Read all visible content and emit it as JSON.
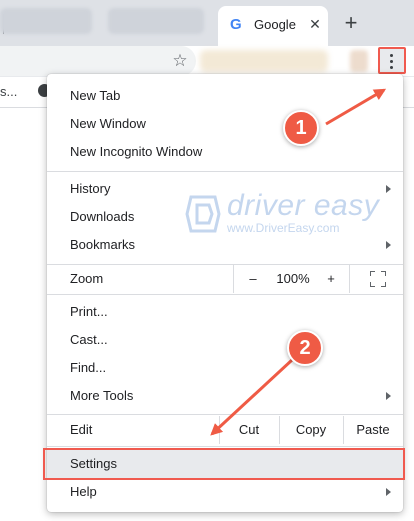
{
  "browser": {
    "active_tab_title": "Google",
    "tab_close_glyph": "✕",
    "new_tab_glyph": "+",
    "favicon_letter": "G",
    "bookmark_star_glyph": "☆",
    "bookmarks_bar_text": "s...",
    "icons": {
      "favicon": "google-g-icon",
      "close": "close-icon",
      "new_tab": "plus-icon",
      "bookmark": "star-icon",
      "menu": "three-dots-vertical-icon"
    }
  },
  "menu": {
    "items": {
      "new_tab": "New Tab",
      "new_window": "New Window",
      "new_incognito": "New Incognito Window",
      "history": "History",
      "downloads": "Downloads",
      "bookmarks": "Bookmarks",
      "zoom": "Zoom",
      "print": "Print...",
      "cast": "Cast...",
      "find": "Find...",
      "more_tools": "More Tools",
      "edit": "Edit",
      "settings": "Settings",
      "help": "Help"
    },
    "zoom": {
      "minus": "–",
      "level": "100%",
      "plus": "+"
    },
    "edit": {
      "cut": "Cut",
      "copy": "Copy",
      "paste": "Paste"
    }
  },
  "watermark": {
    "title": "driver easy",
    "url": "www.DriverEasy.com"
  },
  "callouts": {
    "step1": "1",
    "step2": "2"
  },
  "colors": {
    "accent": "#f05a4f",
    "badge": "#ef5b45",
    "menu_hover": "#e8eaed",
    "watermark": "#c4d6ee"
  }
}
